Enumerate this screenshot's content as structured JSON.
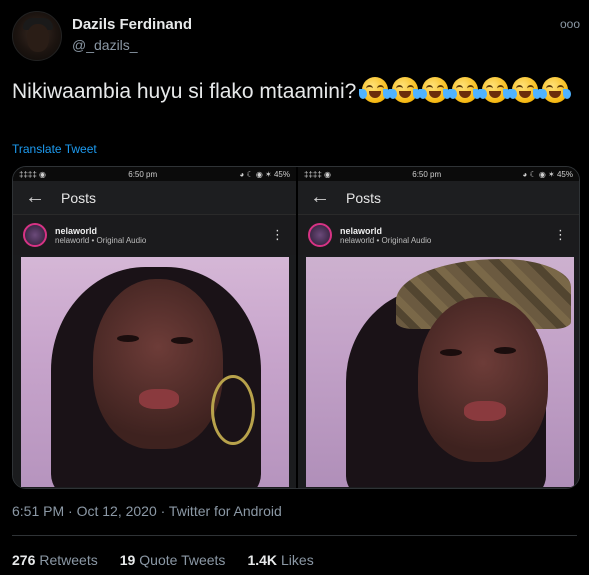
{
  "author": {
    "name": "Dazils Ferdinand",
    "handle": "@_dazils_"
  },
  "menu": {
    "more": "ooo"
  },
  "tweet": {
    "text": "Nikiwaambia huyu si flako mtaamini?",
    "emoji_count": 7,
    "translate_label": "Translate Tweet"
  },
  "screens": [
    {
      "status_left": "‡‡‡‡ ◉",
      "time": "6:50 pm",
      "status_right": "◕ ☾ ◉ ✶ 45%",
      "title": "Posts",
      "user": "nelaworld",
      "subtitle": "nelaworld • Original Audio"
    },
    {
      "status_left": "‡‡‡‡ ◉",
      "time": "6:50 pm",
      "status_right": "◕ ☾ ◉ ✶ 45%",
      "title": "Posts",
      "user": "nelaworld",
      "subtitle": "nelaworld • Original Audio"
    }
  ],
  "meta": {
    "timestamp": "6:51 PM · Oct 12, 2020 · Twitter for Android"
  },
  "stats": {
    "retweets_count": "276",
    "retweets_label": "Retweets",
    "quotes_count": "19",
    "quotes_label": "Quote Tweets",
    "likes_count": "1.4K",
    "likes_label": "Likes"
  },
  "colors": {
    "link": "#1d9bf0",
    "muted": "#8b98a5",
    "text": "#e7e9ea",
    "background": "#000000"
  }
}
